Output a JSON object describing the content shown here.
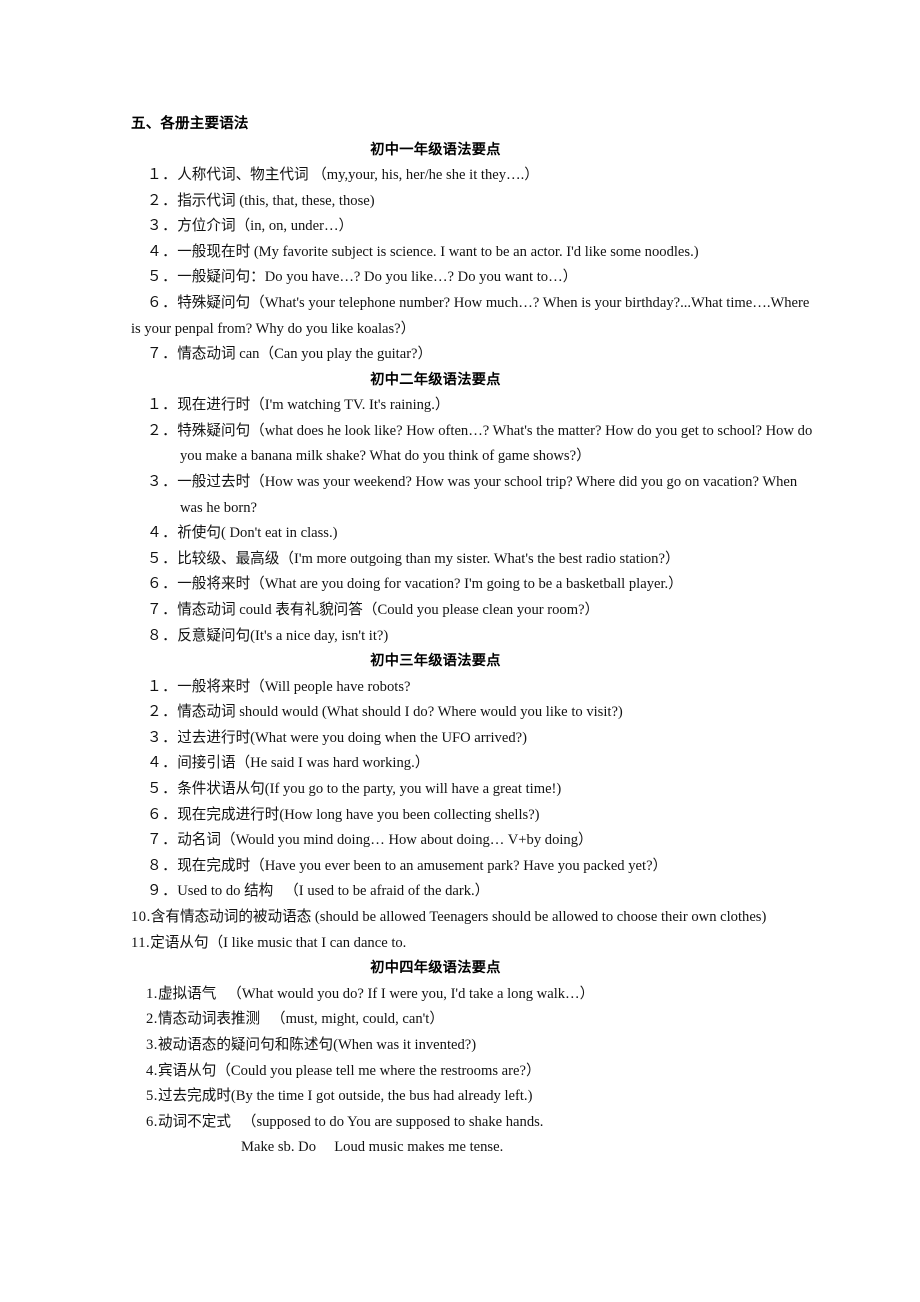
{
  "document": {
    "heading": "五、各册主要语法",
    "sections": [
      {
        "id": "grade1",
        "title": "初中一年级语法要点",
        "items": [
          {
            "num": "１．",
            "text": "人称代词、物主代词 （my,your, his, her/he she it they….）"
          },
          {
            "num": "２．",
            "text": "指示代词 (this, that, these, those)"
          },
          {
            "num": "３．",
            "text": "方位介词（in, on, under…）"
          },
          {
            "num": "４．",
            "text": "一般现在时 (My favorite subject is science. I want to be an actor. I'd like some noodles.)"
          },
          {
            "num": "５．",
            "text": "一般疑问句：Do you have…?  Do you like…?  Do you want to…）"
          },
          {
            "num": "６．",
            "text": "特殊疑问句（What's your telephone number? How much…? When is your birthday?...What time….Where is your penpal from? Why do you like koalas?）"
          },
          {
            "num": "７．",
            "text": "情态动词 can（Can you play the guitar?）"
          }
        ]
      },
      {
        "id": "grade2",
        "title": "初中二年级语法要点",
        "items": [
          {
            "num": "１．",
            "text": "现在进行时（I'm watching TV. It's raining.）"
          },
          {
            "num": "２．",
            "text": "特殊疑问句（what does he look like? How often…? What's the matter? How do you get to school? How do you make a banana milk shake? What do you think of game shows?）"
          },
          {
            "num": "３．",
            "text": "一般过去时（How was your weekend? How was your school trip? Where did you go on vacation? When was he born?"
          },
          {
            "num": "４．",
            "text": "祈使句( Don't eat in class.)"
          },
          {
            "num": "５．",
            "text": "比较级、最高级（I'm more outgoing than my sister. What's the best radio station?）"
          },
          {
            "num": "６．",
            "text": "一般将来时（What are you doing for vacation? I'm going to be a basketball player.）"
          },
          {
            "num": "７．",
            "text": "情态动词 could 表有礼貌问答（Could you please clean your room?）"
          },
          {
            "num": "８．",
            "text": "反意疑问句(It's a nice day, isn't it?)"
          }
        ]
      },
      {
        "id": "grade3",
        "title": "初中三年级语法要点",
        "items": [
          {
            "num": "１．",
            "text": "一般将来时（Will people have robots?"
          },
          {
            "num": "２．",
            "text": "情态动词 should would (What should I do? Where would you like to visit?)"
          },
          {
            "num": "３．",
            "text": "过去进行时(What were you doing when the UFO arrived?)"
          },
          {
            "num": "４．",
            "text": "间接引语（He said I was hard working.）"
          },
          {
            "num": "５．",
            "text": "条件状语从句(If you go to the party, you will have a great time!)"
          },
          {
            "num": "６．",
            "text": "现在完成进行时(How long have you been collecting shells?)"
          },
          {
            "num": "７．",
            "text": "动名词（Would you mind doing… How about doing…  V+by doing）"
          },
          {
            "num": "８．",
            "text": "现在完成时（Have you ever been to an amusement park? Have you packed yet?）"
          },
          {
            "num": "９．",
            "text": "Used to do 结构 　（I used to be afraid of the dark.）"
          },
          {
            "num": "10.",
            "text": "含有情态动词的被动语态 (should be allowed Teenagers should be allowed to choose their own clothes)"
          },
          {
            "num": "11.",
            "text": "定语从句（I like music that I can dance to."
          }
        ]
      },
      {
        "id": "grade4",
        "title": "初中四年级语法要点",
        "items": [
          {
            "num": "1.",
            "text": "虚拟语气 　（What would you do? If I were you, I'd take a long walk…）"
          },
          {
            "num": "2.",
            "text": "情态动词表推测 　（must, might, could, can't）"
          },
          {
            "num": "3.",
            "text": "被动语态的疑问句和陈述句(When was it invented?)"
          },
          {
            "num": "4.",
            "text": "宾语从句（Could you please tell me where the restrooms are?）"
          },
          {
            "num": "5.",
            "text": "过去完成时(By the time I got outside, the bus had already left.)"
          },
          {
            "num": "6.",
            "text": "动词不定式 　（supposed to do  You are supposed to shake hands."
          }
        ],
        "trailing_line": "Make sb. Do 　Loud music makes me tense."
      }
    ]
  }
}
